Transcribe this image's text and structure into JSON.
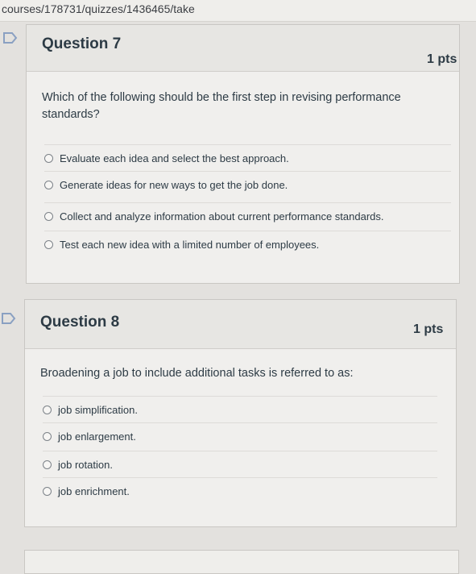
{
  "browser": {
    "url": "courses/178731/quizzes/1436465/take"
  },
  "colors": {
    "flag": "#8aa0c2",
    "card_bg": "#f0efed",
    "header_bg": "#e7e6e3",
    "text": "#2d3b45"
  },
  "questions": [
    {
      "title": "Question 7",
      "points": "1 pts",
      "text": "Which of the following should be the first step in revising performance standards?",
      "answers": [
        "Evaluate each idea and select the best approach.",
        "Generate ideas for new ways to get the job done.",
        "Collect and analyze information about current performance standards.",
        "Test each new idea with a limited number of employees."
      ]
    },
    {
      "title": "Question 8",
      "points": "1 pts",
      "text": "Broadening a job to include additional tasks is referred to as:",
      "answers": [
        "job simplification.",
        "job enlargement.",
        "job rotation.",
        "job enrichment."
      ]
    }
  ]
}
